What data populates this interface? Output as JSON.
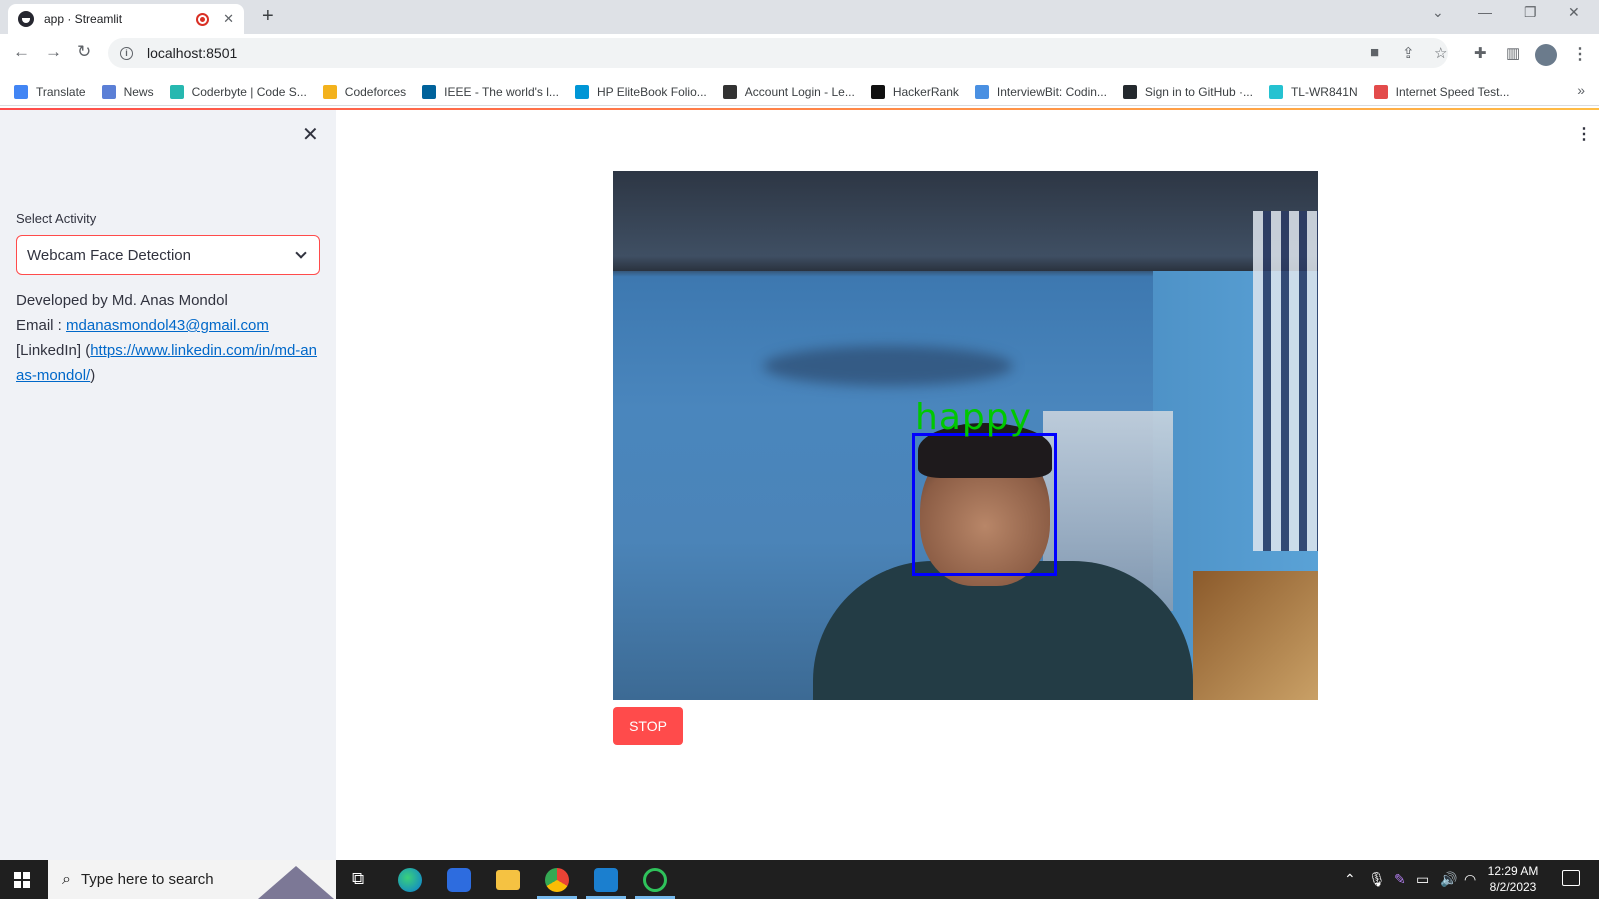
{
  "browser": {
    "tab_title": "app · Streamlit",
    "url": "localhost:8501",
    "bookmarks": [
      {
        "label": "Translate",
        "color": "#4285f4"
      },
      {
        "label": "News",
        "color": "#5b7fd6"
      },
      {
        "label": "Coderbyte | Code S...",
        "color": "#27b8b0"
      },
      {
        "label": "Codeforces",
        "color": "#f3b21d"
      },
      {
        "label": "IEEE - The world's l...",
        "color": "#00629b"
      },
      {
        "label": "HP EliteBook Folio...",
        "color": "#0096d6"
      },
      {
        "label": "Account Login - Le...",
        "color": "#333333"
      },
      {
        "label": "HackerRank",
        "color": "#111111"
      },
      {
        "label": "InterviewBit: Codin...",
        "color": "#4a90e2"
      },
      {
        "label": "Sign in to GitHub ·...",
        "color": "#24292e"
      },
      {
        "label": "TL-WR841N",
        "color": "#25c2d1"
      },
      {
        "label": "Internet Speed Test...",
        "color": "#e34b4b"
      }
    ]
  },
  "sidebar": {
    "select_label": "Select Activity",
    "selected_activity": "Webcam Face Detection",
    "developer_line": "Developed by Md. Anas Mondol",
    "email_prefix": "Email : ",
    "email": "mdanasmondol43@gmail.com",
    "linkedin_prefix": "[LinkedIn] (",
    "linkedin_url": "https://www.linkedin.com/in/md-anas-mondol/",
    "linkedin_suffix": ")"
  },
  "video": {
    "emotion_label": "happy",
    "box_color": "#0000ff",
    "label_color": "#00c800"
  },
  "main": {
    "stop_label": "STOP",
    "accent": "#ff4b4b"
  },
  "taskbar": {
    "search_placeholder": "Type here to search",
    "time": "12:29 AM",
    "date": "8/2/2023"
  }
}
